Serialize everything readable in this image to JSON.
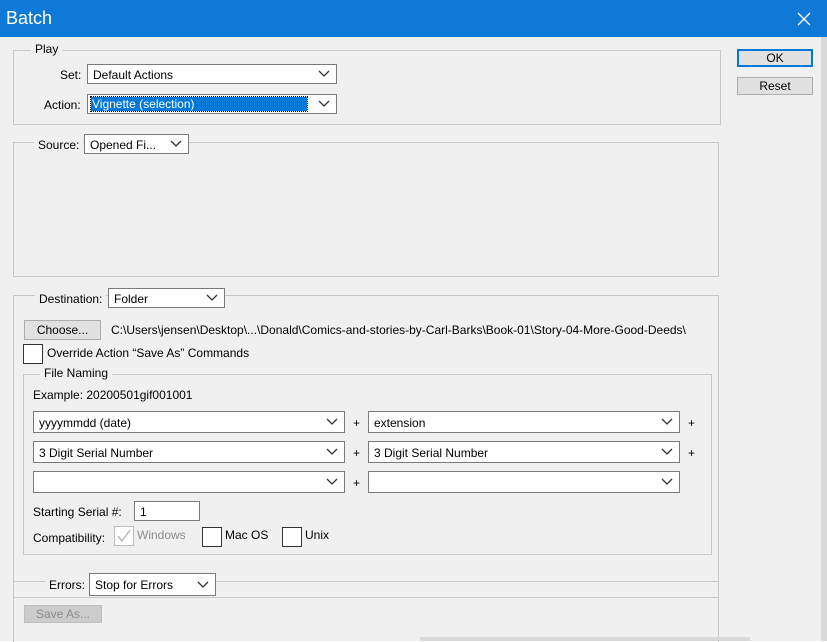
{
  "window": {
    "title": "Batch"
  },
  "buttons": {
    "ok": "OK",
    "reset": "Reset",
    "choose": "Choose...",
    "save_as": "Save As..."
  },
  "play": {
    "legend": "Play",
    "set_label": "Set:",
    "set_value": "Default Actions",
    "action_label": "Action:",
    "action_value": "Vignette (selection)"
  },
  "source": {
    "label": "Source:",
    "value": "Opened Fi..."
  },
  "destination": {
    "label": "Destination:",
    "value": "Folder",
    "path": "C:\\Users\\jensen\\Desktop\\...\\Donald\\Comics-and-stories-by-Carl-Barks\\Book-01\\Story-04-More-Good-Deeds\\",
    "override_label": "Override Action “Save As” Commands",
    "override_checked": false
  },
  "file_naming": {
    "legend": "File Naming",
    "example": "Example: 20200501gif001001",
    "row1": [
      "yyyymmdd (date)",
      "extension"
    ],
    "row2": [
      "3 Digit Serial Number",
      "3 Digit Serial Number"
    ],
    "row3": [
      "",
      ""
    ],
    "plus": "+",
    "starting_serial_label": "Starting Serial #:",
    "starting_serial_value": "1",
    "compat_label": "Compatibility:",
    "windows_label": "Windows",
    "windows_checked": true,
    "macos_label": "Mac OS",
    "macos_checked": false,
    "unix_label": "Unix",
    "unix_checked": false
  },
  "errors": {
    "label": "Errors:",
    "value": "Stop for Errors"
  },
  "colors": {
    "titlebar": "#0f79d8",
    "selection": "#0078d7",
    "dialog_bg": "#f0f0f0"
  }
}
